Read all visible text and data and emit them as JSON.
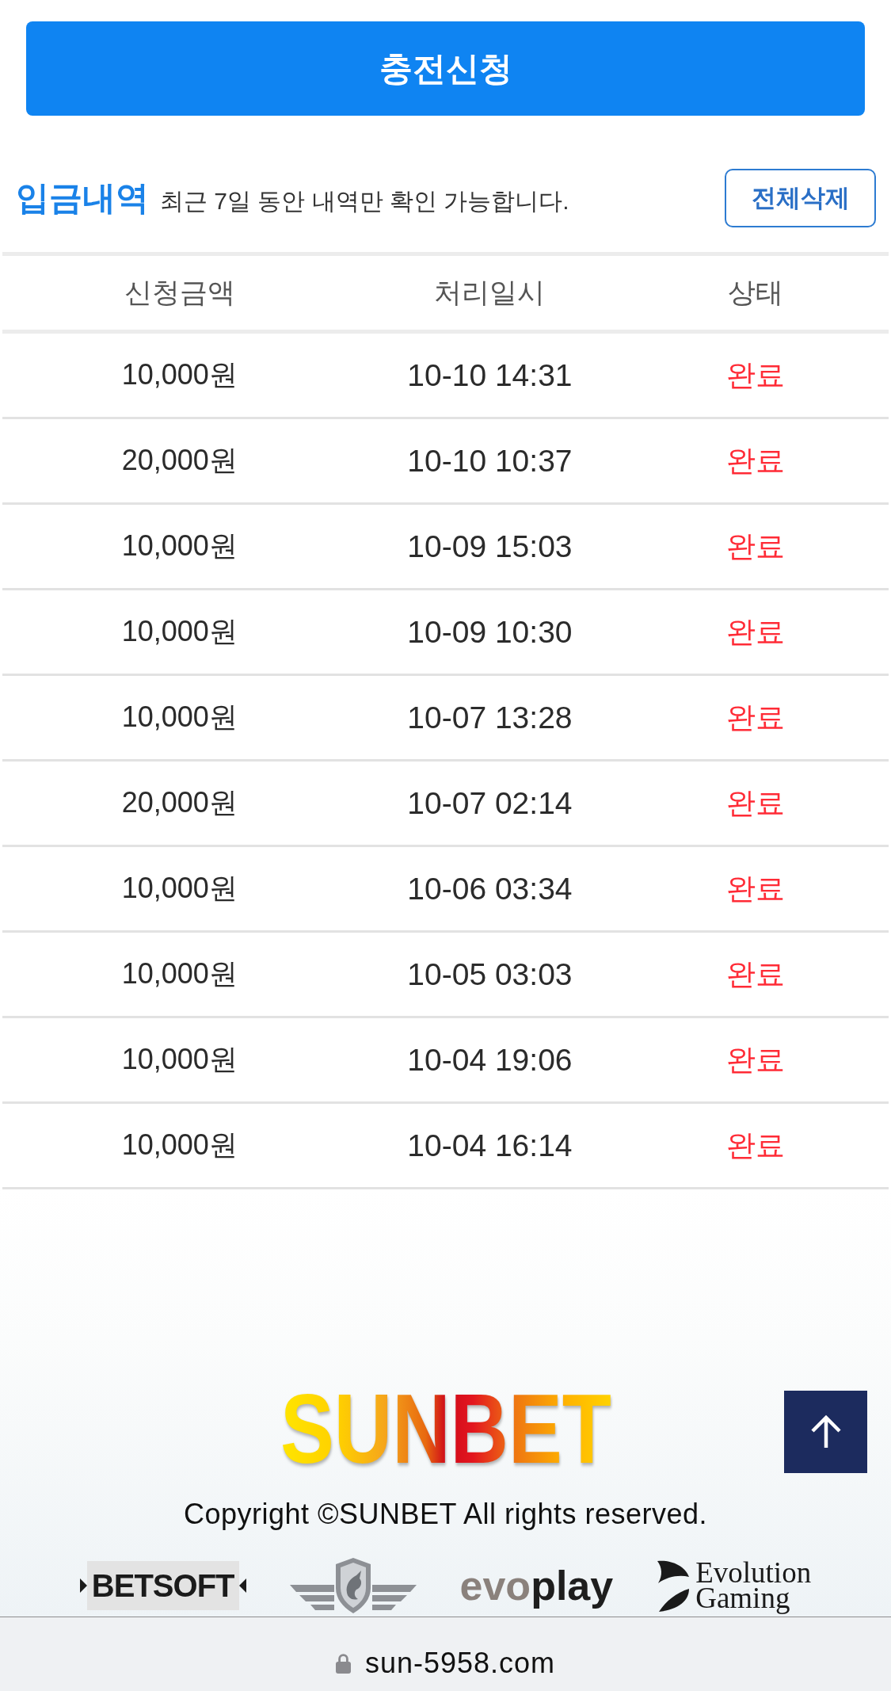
{
  "charge_button": {
    "label": "충전신청"
  },
  "history": {
    "title": "입금내역",
    "subtitle": "최근 7일 동안 내역만 확인 가능합니다.",
    "delete_all_button": "전체삭제"
  },
  "table": {
    "columns": [
      "신청금액",
      "처리일시",
      "상태"
    ],
    "rows": [
      [
        "10,000원",
        "10-10 14:31",
        "완료"
      ],
      [
        "20,000원",
        "10-10 10:37",
        "완료"
      ],
      [
        "10,000원",
        "10-09 15:03",
        "완료"
      ],
      [
        "10,000원",
        "10-09 10:30",
        "완료"
      ],
      [
        "10,000원",
        "10-07 13:28",
        "완료"
      ],
      [
        "20,000원",
        "10-07 02:14",
        "완료"
      ],
      [
        "10,000원",
        "10-06 03:34",
        "완료"
      ],
      [
        "10,000원",
        "10-05 03:03",
        "완료"
      ],
      [
        "10,000원",
        "10-04 19:06",
        "완료"
      ],
      [
        "10,000원",
        "10-04 16:14",
        "완료"
      ]
    ]
  },
  "footer": {
    "logo": "SUNBET",
    "copyright": "Copyright ©SUNBET All rights reserved.",
    "partners": [
      {
        "kind": "tile",
        "name": "BETSOFT"
      },
      {
        "kind": "emblem"
      },
      {
        "kind": "split",
        "name": "evoplay"
      },
      {
        "kind": "mark",
        "name": "Evolution Gaming"
      }
    ]
  },
  "browser_bar": {
    "url": "sun-5958.com"
  }
}
